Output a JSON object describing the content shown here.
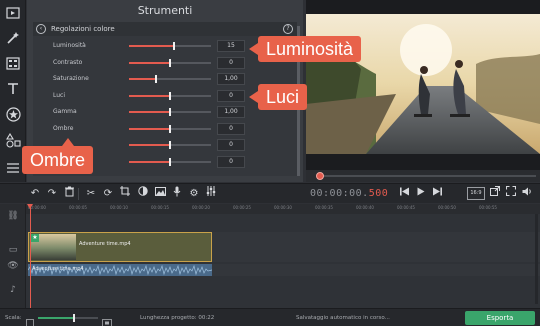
{
  "panel": {
    "title": "Strumenti",
    "section_title": "Regolazioni colore",
    "rows": [
      {
        "label": "Luminosità",
        "value": "15",
        "level": 0.55
      },
      {
        "label": "Contrasto",
        "value": "0",
        "level": 0.5
      },
      {
        "label": "Saturazione",
        "value": "1,00",
        "level": 0.33
      },
      {
        "label": "Luci",
        "value": "0",
        "level": 0.5
      },
      {
        "label": "Gamma",
        "value": "1,00",
        "level": 0.5
      },
      {
        "label": "Ombre",
        "value": "0",
        "level": 0.5
      },
      {
        "label": "",
        "value": "0",
        "level": 0.5
      },
      {
        "label": "",
        "value": "0",
        "level": 0.5
      }
    ]
  },
  "callouts": {
    "luminosita": "Luminosità",
    "luci": "Luci",
    "ombre": "Ombre"
  },
  "player": {
    "timecode_main": "00:00:00.",
    "timecode_ms": "500",
    "progress": 0.03
  },
  "toolbar": {
    "aspect_label": "16:9"
  },
  "ruler_ticks": [
    "00:00:00",
    "00:00:05",
    "00:00:10",
    "00:00:15",
    "00:00:20",
    "00:00:25",
    "00:00:30",
    "00:00:35",
    "00:00:40",
    "00:00:45",
    "00:00:50",
    "00:00:55"
  ],
  "timeline": {
    "video_clip_name": "Adventure time.mp4",
    "audio_clip_name": "Adventure time.mp4"
  },
  "status": {
    "zoom_label": "Scala:",
    "zoom_level": 0.6,
    "project_length": "Lunghezza progetto: 00:22",
    "autosave": "Salvataggio automatico in corso...",
    "export_label": "Esporta"
  },
  "colors": {
    "accent": "#e35b4f",
    "callout": "#e8624a",
    "export": "#3aa56b"
  }
}
